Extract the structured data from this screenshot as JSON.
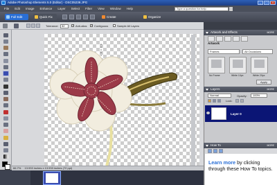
{
  "title_bar": {
    "title": "Adobe Photoshop Elements 5.0 (Editor) - DSC05239.JPG"
  },
  "menu": [
    "File",
    "Edit",
    "Image",
    "Enhance",
    "Layer",
    "Select",
    "Filter",
    "View",
    "Window",
    "Help"
  ],
  "help_search": {
    "placeholder": "Type a question for help"
  },
  "shortcuts": {
    "full_edit": "Full Edit",
    "quick_fix": "Quick Fix",
    "create": "Create",
    "organize": "Organize"
  },
  "options": {
    "tolerance_label": "Tolerance:",
    "tolerance_value": "32",
    "anti_alias": "Anti-alias",
    "contiguous": "Contiguous",
    "sample_all": "Sample All Layers"
  },
  "status": {
    "zoom": "66.7%",
    "dimensions": "13.933 inches x 13.933 inches (72 ppi)"
  },
  "palettes": {
    "artwork_effects": {
      "header": "Artwork and Effects",
      "more": "MORE",
      "section_title": "Artwork",
      "dropdown1": "Frames",
      "dropdown2": "All Occasions",
      "frames": [
        {
          "label": "No Frame"
        },
        {
          "label": "White 10px"
        },
        {
          "label": "White 20px"
        }
      ],
      "apply": "Apply"
    },
    "layers": {
      "header": "Layers",
      "more": "MORE",
      "blend_mode": "Normal",
      "opacity_label": "Opacity:",
      "opacity_value": "100%",
      "lock_label": "Lock:",
      "layer_name": "Layer 0"
    },
    "how_to": {
      "header": "How To",
      "more": "MORE",
      "text_pre": "Learn more",
      "text_post": " by clicking through these How To topics."
    }
  },
  "colors": {
    "accent": "#2a6fd6",
    "selection": "#0b1575",
    "flower_outer": "#f2eddf",
    "flower_inner": "#9b3a48"
  }
}
